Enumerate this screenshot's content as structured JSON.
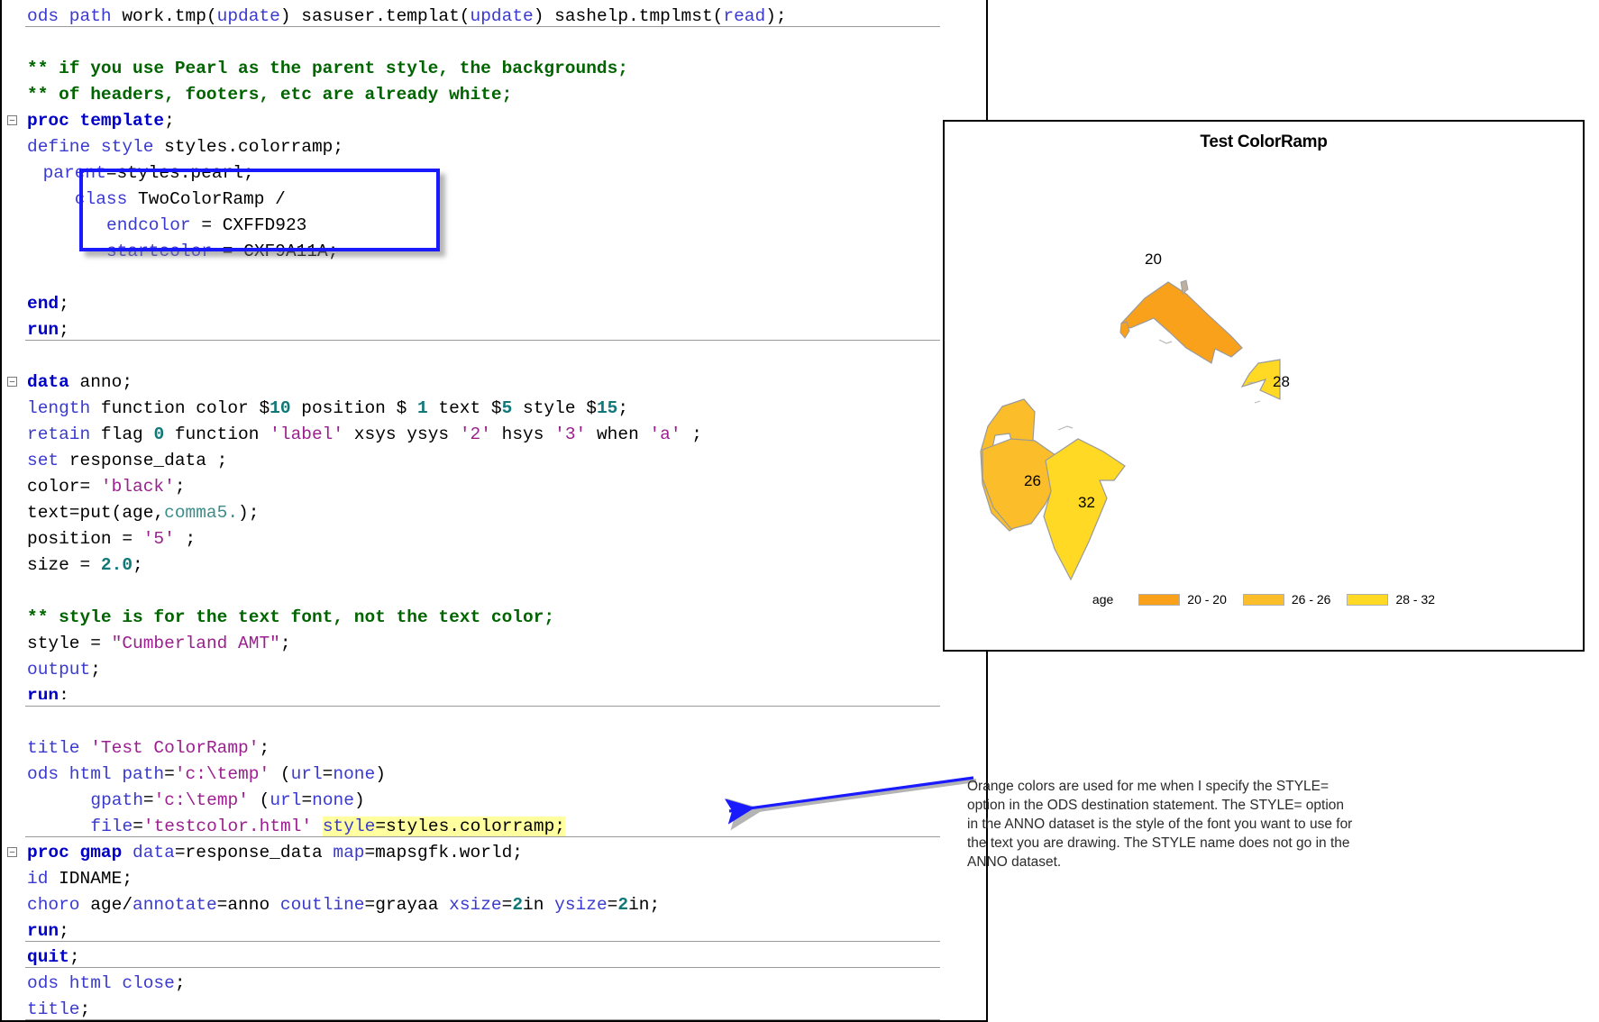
{
  "editor": {
    "lines": [
      {
        "indent": 0,
        "fold": false,
        "sep_after": true,
        "tokens": [
          {
            "t": "ods path ",
            "c": "stmt"
          },
          {
            "t": "work.tmp(",
            "c": "pln"
          },
          {
            "t": "update",
            "c": "stmt"
          },
          {
            "t": ") sasuser.templat(",
            "c": "pln"
          },
          {
            "t": "update",
            "c": "stmt"
          },
          {
            "t": ") sashelp.tmplmst(",
            "c": "pln"
          },
          {
            "t": "read",
            "c": "stmt"
          },
          {
            "t": ");",
            "c": "pln"
          }
        ]
      },
      {
        "indent": 0,
        "fold": false,
        "sep_after": false,
        "tokens": []
      },
      {
        "indent": 0,
        "fold": false,
        "sep_after": false,
        "tokens": [
          {
            "t": "** if you use Pearl as the parent style, the backgrounds;",
            "c": "cmt"
          }
        ]
      },
      {
        "indent": 0,
        "fold": false,
        "sep_after": false,
        "tokens": [
          {
            "t": "** of headers, footers, etc are already white;",
            "c": "cmt"
          }
        ]
      },
      {
        "indent": 0,
        "fold": true,
        "sep_after": false,
        "tokens": [
          {
            "t": "proc template",
            "c": "kw"
          },
          {
            "t": ";",
            "c": "pln"
          }
        ]
      },
      {
        "indent": 0,
        "fold": false,
        "sep_after": false,
        "tokens": [
          {
            "t": "define style ",
            "c": "stmt"
          },
          {
            "t": "styles.colorramp;",
            "c": "pln"
          }
        ]
      },
      {
        "indent": 1,
        "fold": false,
        "sep_after": false,
        "tokens": [
          {
            "t": "parent",
            "c": "stmt"
          },
          {
            "t": "=styles.pearl;",
            "c": "pln"
          }
        ]
      },
      {
        "indent": 3,
        "fold": false,
        "sep_after": false,
        "tokens": [
          {
            "t": "class ",
            "c": "stmt"
          },
          {
            "t": "TwoColorRamp /",
            "c": "pln"
          }
        ]
      },
      {
        "indent": 5,
        "fold": false,
        "sep_after": false,
        "tokens": [
          {
            "t": "endcolor",
            "c": "stmt"
          },
          {
            "t": " = CXFFD923",
            "c": "pln"
          }
        ]
      },
      {
        "indent": 5,
        "fold": false,
        "sep_after": false,
        "tokens": [
          {
            "t": "startcolor",
            "c": "stmt"
          },
          {
            "t": " = CXF9A11A;",
            "c": "pln"
          }
        ]
      },
      {
        "indent": 0,
        "fold": false,
        "sep_after": false,
        "tokens": []
      },
      {
        "indent": 0,
        "fold": false,
        "sep_after": false,
        "tokens": [
          {
            "t": "end",
            "c": "kw"
          },
          {
            "t": ";",
            "c": "pln"
          }
        ]
      },
      {
        "indent": 0,
        "fold": false,
        "sep_after": true,
        "tokens": [
          {
            "t": "run",
            "c": "kw"
          },
          {
            "t": ";",
            "c": "pln"
          }
        ]
      },
      {
        "indent": 0,
        "fold": false,
        "sep_after": false,
        "tokens": []
      },
      {
        "indent": 0,
        "fold": true,
        "sep_after": false,
        "tokens": [
          {
            "t": "data ",
            "c": "kw"
          },
          {
            "t": "anno;",
            "c": "pln"
          }
        ]
      },
      {
        "indent": 0,
        "fold": false,
        "sep_after": false,
        "tokens": [
          {
            "t": "length ",
            "c": "stmt"
          },
          {
            "t": "function color $",
            "c": "pln"
          },
          {
            "t": "10",
            "c": "num"
          },
          {
            "t": " position $ ",
            "c": "pln"
          },
          {
            "t": "1",
            "c": "num"
          },
          {
            "t": " text $",
            "c": "pln"
          },
          {
            "t": "5",
            "c": "num"
          },
          {
            "t": " style $",
            "c": "pln"
          },
          {
            "t": "15",
            "c": "num"
          },
          {
            "t": ";",
            "c": "pln"
          }
        ]
      },
      {
        "indent": 0,
        "fold": false,
        "sep_after": false,
        "tokens": [
          {
            "t": "retain ",
            "c": "stmt"
          },
          {
            "t": "flag ",
            "c": "pln"
          },
          {
            "t": "0",
            "c": "num"
          },
          {
            "t": " function ",
            "c": "pln"
          },
          {
            "t": "'label'",
            "c": "str"
          },
          {
            "t": " xsys ysys ",
            "c": "pln"
          },
          {
            "t": "'2'",
            "c": "str"
          },
          {
            "t": " hsys ",
            "c": "pln"
          },
          {
            "t": "'3'",
            "c": "str"
          },
          {
            "t": " when ",
            "c": "pln"
          },
          {
            "t": "'a'",
            "c": "str"
          },
          {
            "t": " ;",
            "c": "pln"
          }
        ]
      },
      {
        "indent": 0,
        "fold": false,
        "sep_after": false,
        "tokens": [
          {
            "t": "set ",
            "c": "stmt"
          },
          {
            "t": "response_data ;",
            "c": "pln"
          }
        ]
      },
      {
        "indent": 0,
        "fold": false,
        "sep_after": false,
        "tokens": [
          {
            "t": "color= ",
            "c": "pln"
          },
          {
            "t": "'black'",
            "c": "str"
          },
          {
            "t": ";",
            "c": "pln"
          }
        ]
      },
      {
        "indent": 0,
        "fold": false,
        "sep_after": false,
        "tokens": [
          {
            "t": "text=put(age,",
            "c": "pln"
          },
          {
            "t": "comma5.",
            "c": "fmt"
          },
          {
            "t": ");",
            "c": "pln"
          }
        ]
      },
      {
        "indent": 0,
        "fold": false,
        "sep_after": false,
        "tokens": [
          {
            "t": "position = ",
            "c": "pln"
          },
          {
            "t": "'5'",
            "c": "str"
          },
          {
            "t": " ;",
            "c": "pln"
          }
        ]
      },
      {
        "indent": 0,
        "fold": false,
        "sep_after": false,
        "tokens": [
          {
            "t": "size = ",
            "c": "pln"
          },
          {
            "t": "2.0",
            "c": "num"
          },
          {
            "t": ";",
            "c": "pln"
          }
        ]
      },
      {
        "indent": 0,
        "fold": false,
        "sep_after": false,
        "tokens": []
      },
      {
        "indent": 0,
        "fold": false,
        "sep_after": false,
        "tokens": [
          {
            "t": "** style is for the text font, not the text color;",
            "c": "cmt"
          }
        ]
      },
      {
        "indent": 0,
        "fold": false,
        "sep_after": false,
        "tokens": [
          {
            "t": "style = ",
            "c": "pln"
          },
          {
            "t": "\"Cumberland AMT\"",
            "c": "str"
          },
          {
            "t": ";",
            "c": "pln"
          }
        ]
      },
      {
        "indent": 0,
        "fold": false,
        "sep_after": false,
        "tokens": [
          {
            "t": "output",
            "c": "stmt"
          },
          {
            "t": ";",
            "c": "pln"
          }
        ]
      },
      {
        "indent": 0,
        "fold": false,
        "sep_after": true,
        "clip": true,
        "tokens": [
          {
            "t": "run",
            "c": "kw"
          },
          {
            "t": ";",
            "c": "pln"
          }
        ]
      },
      {
        "indent": 0,
        "fold": false,
        "sep_after": false,
        "tokens": []
      },
      {
        "indent": 0,
        "fold": false,
        "sep_after": false,
        "tokens": [
          {
            "t": "title ",
            "c": "stmt"
          },
          {
            "t": "'Test ColorRamp'",
            "c": "str"
          },
          {
            "t": ";",
            "c": "pln"
          }
        ]
      },
      {
        "indent": 0,
        "fold": false,
        "sep_after": false,
        "tokens": [
          {
            "t": "ods html path",
            "c": "stmt"
          },
          {
            "t": "=",
            "c": "pln"
          },
          {
            "t": "'c:\\temp'",
            "c": "str"
          },
          {
            "t": " (",
            "c": "pln"
          },
          {
            "t": "url",
            "c": "stmt"
          },
          {
            "t": "=",
            "c": "pln"
          },
          {
            "t": "none",
            "c": "stmt"
          },
          {
            "t": ")",
            "c": "pln"
          }
        ]
      },
      {
        "indent": 4,
        "fold": false,
        "sep_after": false,
        "tokens": [
          {
            "t": "gpath",
            "c": "stmt"
          },
          {
            "t": "=",
            "c": "pln"
          },
          {
            "t": "'c:\\temp'",
            "c": "str"
          },
          {
            "t": " (",
            "c": "pln"
          },
          {
            "t": "url",
            "c": "stmt"
          },
          {
            "t": "=",
            "c": "pln"
          },
          {
            "t": "none",
            "c": "stmt"
          },
          {
            "t": ")",
            "c": "pln"
          }
        ]
      },
      {
        "indent": 4,
        "fold": false,
        "sep_after": true,
        "tokens": [
          {
            "t": "file",
            "c": "stmt"
          },
          {
            "t": "=",
            "c": "pln"
          },
          {
            "t": "'testcolor.html'",
            "c": "str"
          },
          {
            "t": " ",
            "c": "pln"
          },
          {
            "t": "style",
            "c": "stmt",
            "hl": true
          },
          {
            "t": "=styles.colorramp;",
            "c": "pln",
            "hl": true
          }
        ]
      },
      {
        "indent": 0,
        "fold": true,
        "sep_after": false,
        "tokens": [
          {
            "t": "proc gmap ",
            "c": "kw"
          },
          {
            "t": "data",
            "c": "stmt"
          },
          {
            "t": "=response_data ",
            "c": "pln"
          },
          {
            "t": "map",
            "c": "stmt"
          },
          {
            "t": "=mapsgfk.world;",
            "c": "pln"
          }
        ]
      },
      {
        "indent": 0,
        "fold": false,
        "sep_after": false,
        "tokens": [
          {
            "t": "id ",
            "c": "stmt"
          },
          {
            "t": "IDNAME;",
            "c": "pln"
          }
        ]
      },
      {
        "indent": 0,
        "fold": false,
        "sep_after": false,
        "tokens": [
          {
            "t": "choro ",
            "c": "stmt"
          },
          {
            "t": "age/",
            "c": "pln"
          },
          {
            "t": "annotate",
            "c": "stmt"
          },
          {
            "t": "=anno ",
            "c": "pln"
          },
          {
            "t": "coutline",
            "c": "stmt"
          },
          {
            "t": "=grayaa ",
            "c": "pln"
          },
          {
            "t": "xsize",
            "c": "stmt"
          },
          {
            "t": "=",
            "c": "pln"
          },
          {
            "t": "2",
            "c": "num"
          },
          {
            "t": "in ",
            "c": "pln"
          },
          {
            "t": "ysize",
            "c": "stmt"
          },
          {
            "t": "=",
            "c": "pln"
          },
          {
            "t": "2",
            "c": "num"
          },
          {
            "t": "in;",
            "c": "pln"
          }
        ]
      },
      {
        "indent": 0,
        "fold": false,
        "sep_after": true,
        "tokens": [
          {
            "t": "run",
            "c": "kw"
          },
          {
            "t": ";",
            "c": "pln"
          }
        ]
      },
      {
        "indent": 0,
        "fold": false,
        "sep_after": true,
        "tokens": [
          {
            "t": "quit",
            "c": "kw"
          },
          {
            "t": ";",
            "c": "pln"
          }
        ]
      },
      {
        "indent": 0,
        "fold": false,
        "sep_after": false,
        "tokens": [
          {
            "t": "ods html close",
            "c": "stmt"
          },
          {
            "t": ";",
            "c": "pln"
          }
        ]
      },
      {
        "indent": 0,
        "fold": false,
        "sep_after": true,
        "tokens": [
          {
            "t": "title",
            "c": "stmt"
          },
          {
            "t": ";",
            "c": "pln"
          }
        ]
      }
    ]
  },
  "callout_box": {
    "name": "class-twocolorramp-highlight-box",
    "border_color": "#1a1aff"
  },
  "map_panel": {
    "title": "Test ColorRamp",
    "legend": {
      "title": "age",
      "items": [
        {
          "label": "20 - 20",
          "color": "#F9A11A"
        },
        {
          "label": "26 - 26",
          "color": "#FBBD2A"
        },
        {
          "label": "28 - 32",
          "color": "#FFD923"
        }
      ]
    }
  },
  "chart_data": {
    "type": "map",
    "title": "Test ColorRamp",
    "response_variable": "age",
    "outline_color": "#9a9a9a",
    "ramp": {
      "startcolor": "CXF9A11A",
      "endcolor": "CXFFD923"
    },
    "legend_title": "age",
    "legend_bins": [
      {
        "label": "20 - 20",
        "color": "#F9A11A",
        "min": 20,
        "max": 20
      },
      {
        "label": "26 - 26",
        "color": "#FBBD2A",
        "min": 26,
        "max": 26
      },
      {
        "label": "28 - 32",
        "color": "#FFD923",
        "min": 28,
        "max": 32
      }
    ],
    "regions": [
      {
        "label": "20",
        "value": 20,
        "color": "#F9A11A"
      },
      {
        "label": "28",
        "value": 28,
        "color": "#FFD923"
      },
      {
        "label": "26",
        "value": 26,
        "color": "#FBBD2A"
      },
      {
        "label": "32",
        "value": 32,
        "color": "#FFD923"
      }
    ]
  },
  "annotation": {
    "text": "Orange colors are used for me when I specify the STYLE= option in the ODS destination statement. The STYLE= option in the ANNO dataset is the style of the font you want to use for the text you are drawing. The STYLE name does not go in the ANNO dataset.",
    "arrow_color": "#1a1aff"
  }
}
